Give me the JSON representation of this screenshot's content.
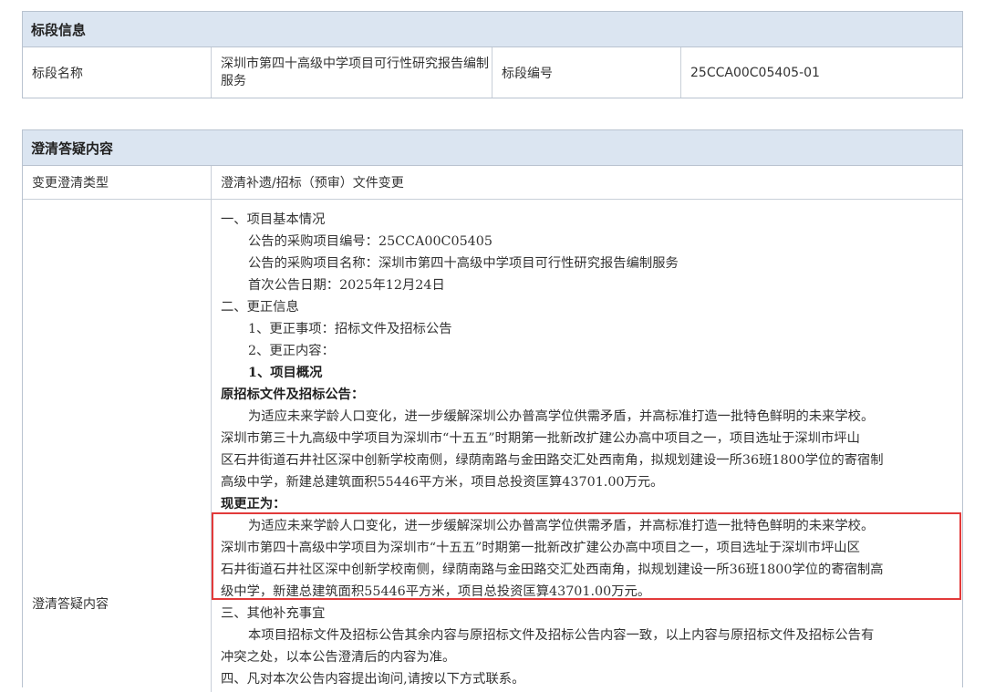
{
  "bid_info": {
    "header": "标段信息",
    "name_label": "标段名称",
    "name_value_line1": "深圳市第四十高级中学项目可行性研究报告编制",
    "name_value_line2": "服务",
    "code_label": "标段编号",
    "code_value": "25CCA00C05405-01"
  },
  "clarify": {
    "header": "澄清答疑内容",
    "type_label": "变更澄清类型",
    "type_value": "澄清补遗/招标（预审）文件变更",
    "content_label": "澄清答疑内容",
    "lines": [
      "一、项目基本情况",
      "公告的采购项目编号：25CCA00C05405",
      "公告的采购项目名称：深圳市第四十高级中学项目可行性研究报告编制服务",
      "首次公告日期：2025年12月24日",
      "二、更正信息",
      "1、更正事项：招标文件及招标公告",
      "2、更正内容：",
      "1、项目概况",
      "原招标文件及招标公告：",
      "为适应未来学龄人口变化，进一步缓解深圳公办普高学位供需矛盾，并高标准打造一批特色鲜明的未来学校。",
      "深圳市第三十九高级中学项目为深圳市“十五五”时期第一批新改扩建公办高中项目之一，项目选址于深圳市坪山",
      "区石井街道石井社区深中创新学校南侧，绿荫南路与金田路交汇处西南角，拟规划建设一所36班1800学位的寄宿制",
      "高级中学，新建总建筑面积55446平方米，项目总投资匡算43701.00万元。",
      "现更正为：",
      "为适应未来学龄人口变化，进一步缓解深圳公办普高学位供需矛盾，并高标准打造一批特色鲜明的未来学校。",
      "深圳市第四十高级中学项目为深圳市“十五五”时期第一批新改扩建公办高中项目之一，项目选址于深圳市坪山区",
      "石井街道石井社区深中创新学校南侧，绿荫南路与金田路交汇处西南角，拟规划建设一所36班1800学位的寄宿制高",
      "级中学，新建总建筑面积55446平方米，项目总投资匡算43701.00万元。",
      "三、其他补充事宜",
      "本项目招标文件及招标公告其余内容与原招标文件及招标公告内容一致，以上内容与原招标文件及招标公告有",
      "冲突之处，以本公告澄清后的内容为准。",
      "四、凡对本次公告内容提出询问,请按以下方式联系。"
    ]
  },
  "colors": {
    "header_bg": "#dbe5f1",
    "border": "#b9c3d0",
    "highlight": "#e23a3a"
  }
}
